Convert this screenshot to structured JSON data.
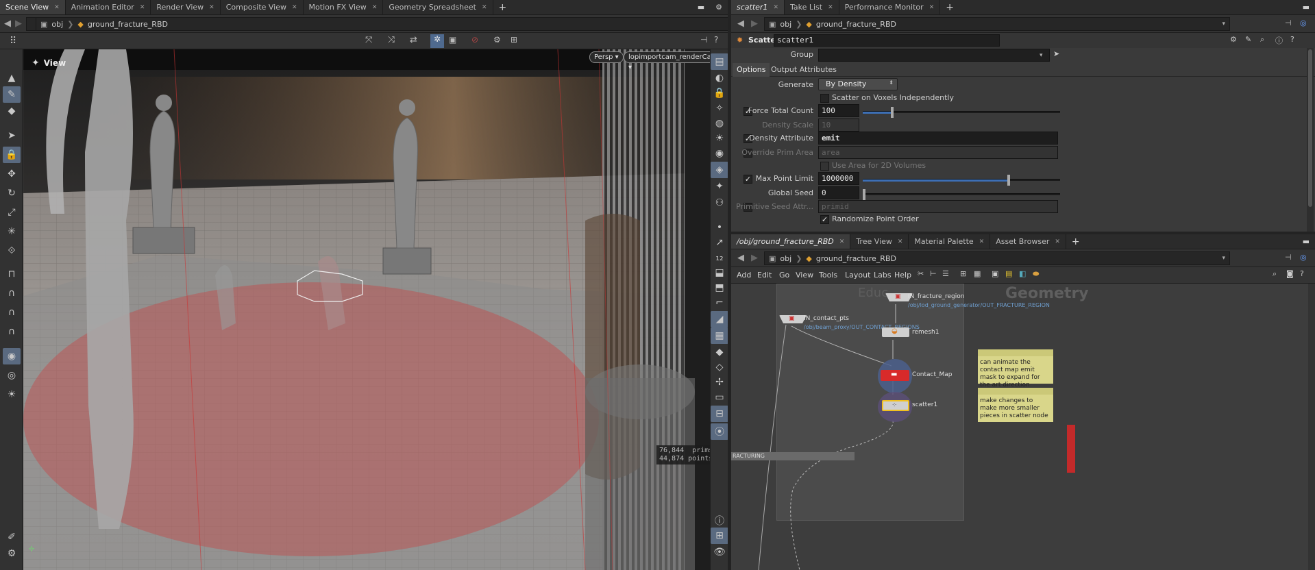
{
  "left_tabs": [
    {
      "label": "Scene View",
      "active": true
    },
    {
      "label": "Animation Editor"
    },
    {
      "label": "Render View"
    },
    {
      "label": "Composite View"
    },
    {
      "label": "Motion FX View"
    },
    {
      "label": "Geometry Spreadsheet"
    }
  ],
  "right_tabs": [
    {
      "label": "scatter1",
      "active": true
    },
    {
      "label": "Take List"
    },
    {
      "label": "Performance Monitor"
    }
  ],
  "net_tabs": [
    {
      "label": "/obj/ground_fracture_RBD",
      "active": true
    },
    {
      "label": "Tree View"
    },
    {
      "label": "Material Palette"
    },
    {
      "label": "Asset Browser"
    }
  ],
  "path": {
    "context": "obj",
    "node": "ground_fracture_RBD"
  },
  "viewport": {
    "title": "View",
    "persp": "Persp",
    "camera": "lopimportcam_renderCam",
    "prims_value": "76,844",
    "prims_label": "prims",
    "points_value": "44,874",
    "points_label": "points"
  },
  "params": {
    "node_type": "Scatter",
    "node_name": "scatter1",
    "group_label": "Group",
    "group_value": "",
    "tabs": [
      "Options",
      "Output Attributes"
    ],
    "generate_label": "Generate",
    "generate_value": "By Density",
    "scatter_voxels": "Scatter on Voxels Independently",
    "force_total_label": "Force Total Count",
    "force_total_value": "100",
    "force_total_fill": 0.15,
    "density_scale_label": "Density Scale",
    "density_scale_value": "10",
    "density_attr_label": "Density Attribute",
    "density_attr_value": "emit",
    "override_label": "Override Prim Area",
    "override_value": "area",
    "use_area": "Use Area for 2D Volumes",
    "max_point_label": "Max Point Limit",
    "max_point_value": "1000000",
    "max_point_fill": 0.74,
    "global_seed_label": "Global Seed",
    "global_seed_value": "0",
    "prim_seed_label": "Primitive Seed Attr...",
    "prim_seed_value": "primid",
    "randomize": "Randomize Point Order"
  },
  "net_menu": [
    "Add",
    "Edit",
    "Go",
    "View",
    "Tools",
    "Layout",
    "Labs",
    "Help"
  ],
  "network": {
    "box_title": "Educ...",
    "context_label": "Geometry",
    "nodes": [
      {
        "name": "IN_fracture_region",
        "path": "/obj/lod_ground_generator/OUT_FRACTURE_REGION"
      },
      {
        "name": "IN_contact_pts",
        "path": "/obj/beam_proxy/OUT_CONTACT_REGIONS"
      },
      {
        "name": "remesh1"
      },
      {
        "name": "Contact_Map"
      },
      {
        "name": "scatter1"
      }
    ],
    "notes": [
      "can animate the contact map emit mask to expand for the art direction",
      "make changes to make more smaller pieces in scatter node"
    ],
    "bottom_box": "RACTURING"
  },
  "colors": {
    "accent": "#3d6fb5",
    "sticky": "#d9d68a",
    "contact_node": "#d82a2a",
    "scatter_node": "#f0c020"
  }
}
